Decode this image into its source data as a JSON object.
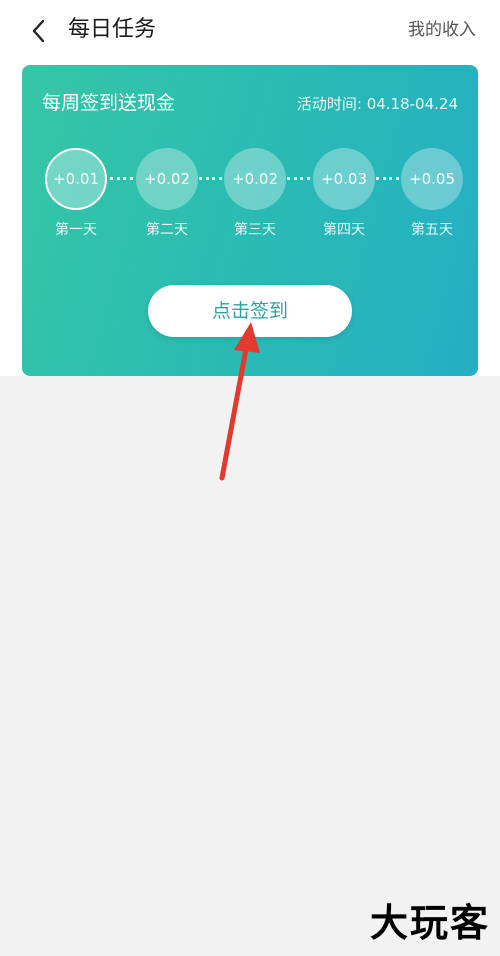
{
  "nav": {
    "back_icon": "chevron-left-icon",
    "title": "每日任务",
    "right_link": "我的收入"
  },
  "card": {
    "title": "每周签到送现金",
    "activity": "活动时间: 04.18-04.24",
    "days": [
      {
        "amount": "+0.01",
        "label": "第一天",
        "current": true
      },
      {
        "amount": "+0.02",
        "label": "第二天",
        "current": false
      },
      {
        "amount": "+0.02",
        "label": "第三天",
        "current": false
      },
      {
        "amount": "+0.03",
        "label": "第四天",
        "current": false
      },
      {
        "amount": "+0.05",
        "label": "第五天",
        "current": false
      }
    ],
    "signin_button": "点击签到"
  },
  "annotation": {
    "arrow_color": "#e23b2e"
  },
  "watermark": {
    "brand": "大玩客"
  },
  "colors": {
    "card_start": "#36c6a6",
    "card_end": "#24afc4",
    "button_text": "#2aa5a0",
    "page_bg": "#f2f2f2"
  }
}
